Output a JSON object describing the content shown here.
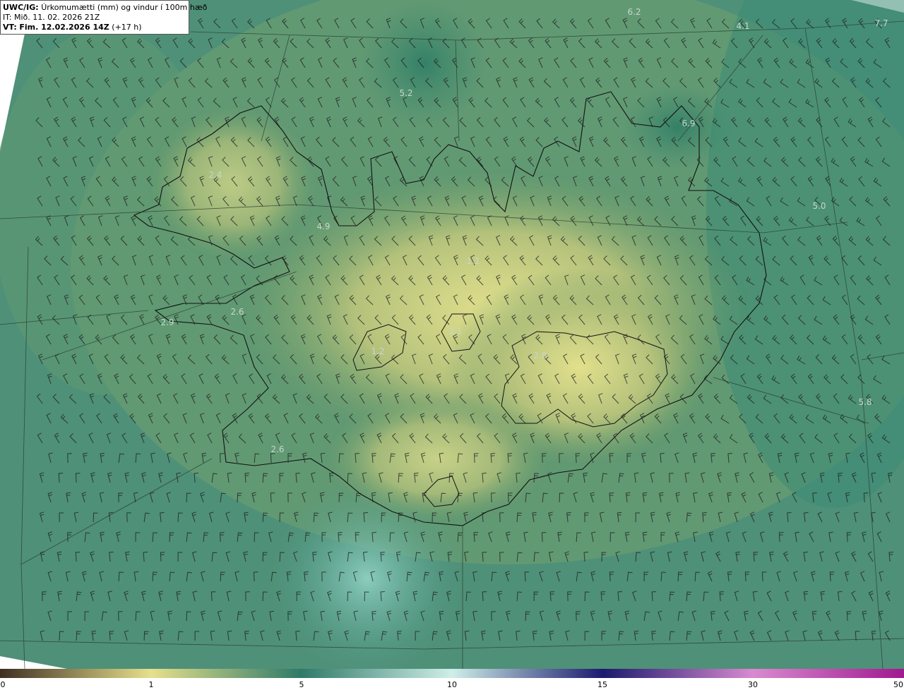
{
  "header": {
    "model": "UWC/IG:",
    "title": "Úrkomumætti (mm) og vindur í 100m hæð",
    "init_time": "IT: Mið. 11. 02. 2026 21Z",
    "valid_prefix": "VT:",
    "valid_time": "Fim. 12.02.2026 14Z",
    "lead": "(+17 h)"
  },
  "map_values": [
    {
      "id": "v1",
      "text": "6.2"
    },
    {
      "id": "v2",
      "text": "4.1"
    },
    {
      "id": "v3",
      "text": "7.7"
    },
    {
      "id": "v4",
      "text": "5.2"
    },
    {
      "id": "v5",
      "text": "6.9"
    },
    {
      "id": "v6",
      "text": "2.4"
    },
    {
      "id": "v7",
      "text": "4.9"
    },
    {
      "id": "v8",
      "text": "5.0"
    },
    {
      "id": "v9",
      "text": "2.6"
    },
    {
      "id": "v10",
      "text": "2.9"
    },
    {
      "id": "v11",
      "text": "2.1"
    },
    {
      "id": "v12",
      "text": "5.8"
    },
    {
      "id": "v13",
      "text": "2.6"
    },
    {
      "id": "v14",
      "text": "1.1"
    },
    {
      "id": "v15",
      "text": "2.0"
    },
    {
      "id": "v16",
      "text": "1.2"
    }
  ],
  "colorbar": {
    "ticks": [
      "0",
      "1",
      "5",
      "10",
      "15",
      "30",
      "50"
    ],
    "colors": [
      "#3f2f22",
      "#e6e08c",
      "#2f7a68",
      "#cfeee8",
      "#1a1a6e",
      "#d98ad0",
      "#a01a90"
    ]
  }
}
